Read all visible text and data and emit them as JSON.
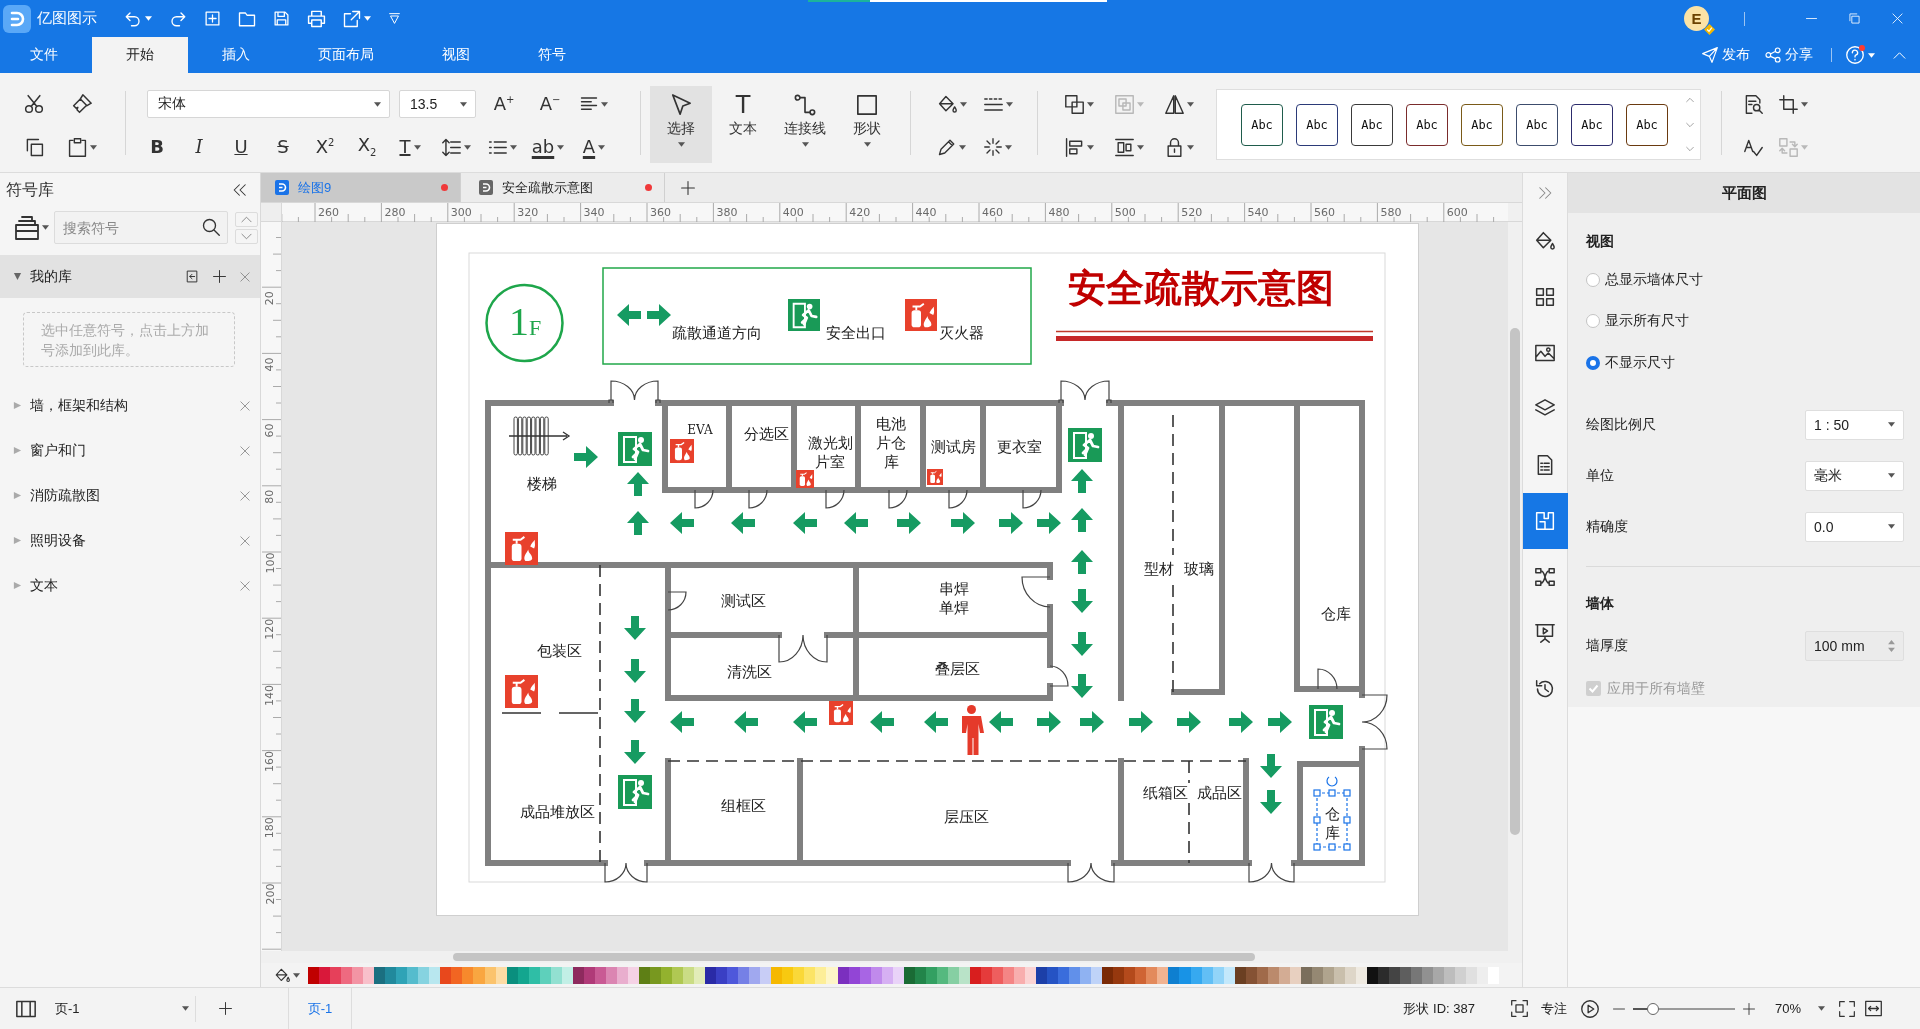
{
  "app": {
    "name": "亿图图示",
    "avatar": "E",
    "help_alert": true
  },
  "header_actions": [
    {
      "kind": "publish",
      "label": "发布"
    },
    {
      "kind": "share",
      "label": "分享"
    }
  ],
  "menu_tabs": [
    {
      "label": "文件",
      "selected": false
    },
    {
      "label": "开始",
      "selected": true
    },
    {
      "label": "插入",
      "selected": false
    },
    {
      "label": "页面布局",
      "selected": false
    },
    {
      "label": "视图",
      "selected": false
    },
    {
      "label": "符号",
      "selected": false
    }
  ],
  "ribbon": {
    "font_family": "宋体",
    "font_size": "13.5",
    "size_buttons": [
      {
        "glyph": "A$^{+}$"
      },
      {
        "glyph": "A$^{−}$"
      }
    ],
    "format_buttons": [
      {
        "kind": "bold",
        "glyph": "B"
      },
      {
        "kind": "italic",
        "glyph": "I"
      },
      {
        "kind": "underline",
        "glyph": "U"
      },
      {
        "kind": "strike",
        "glyph": "S"
      },
      {
        "kind": "script",
        "glyph": "X$^{2}$"
      },
      {
        "kind": "script",
        "glyph": "X$_{2}$"
      },
      {
        "kind": "style",
        "glyph": "T"
      },
      {
        "kind": "spacing"
      },
      {
        "kind": "bullets"
      },
      {
        "kind": "highlight",
        "glyph": "ab"
      },
      {
        "kind": "color",
        "glyph": "A"
      }
    ],
    "tools": [
      {
        "kind": "select",
        "label": "选择",
        "selected": true
      },
      {
        "kind": "text",
        "label": "文本",
        "glyph": "T",
        "selected": false
      },
      {
        "kind": "connector",
        "label": "连接线",
        "selected": false
      },
      {
        "kind": "shape",
        "label": "形状",
        "selected": false
      }
    ],
    "arrange_tools": [
      {
        "kind": "front",
        "disabled": false
      },
      {
        "kind": "group",
        "disabled": true
      },
      {
        "kind": "flip",
        "disabled": false
      },
      {
        "kind": "align",
        "disabled": false
      },
      {
        "kind": "distribute",
        "disabled": false
      },
      {
        "kind": "lock",
        "disabled": false
      }
    ],
    "style_gallery": [
      {
        "label": "Abc",
        "color": "#1f5c4c"
      },
      {
        "label": "Abc",
        "color": "#2b3a78"
      },
      {
        "label": "Abc",
        "color": "#3a3a3a"
      },
      {
        "label": "Abc",
        "color": "#7a2c2c"
      },
      {
        "label": "Abc",
        "color": "#7a5a18"
      },
      {
        "label": "Abc",
        "color": "#3c4c6c"
      },
      {
        "label": "Abc",
        "color": "#2c2c6c"
      },
      {
        "label": "Abc",
        "color": "#6a3a10"
      }
    ],
    "edit_tools": [
      {
        "kind": "find",
        "disabled": false
      },
      {
        "kind": "crop",
        "disabled": false
      },
      {
        "kind": "spell",
        "disabled": false
      },
      {
        "kind": "replace",
        "disabled": true
      }
    ]
  },
  "library": {
    "title": "符号库",
    "search": {
      "placeholder": "搜索符号"
    },
    "my_library": {
      "label": "我的库",
      "expanded": true,
      "hint": "选中任意符号，点击上方加号添加到此库。"
    },
    "categories": [
      {
        "label": "墙，框架和结构",
        "expanded": false
      },
      {
        "label": "窗户和门",
        "expanded": false
      },
      {
        "label": "消防疏散图",
        "expanded": false
      },
      {
        "label": "照明设备",
        "expanded": false
      },
      {
        "label": "文本",
        "expanded": false
      }
    ]
  },
  "doc_tabs": [
    {
      "label": "绘图9",
      "selected": true,
      "modified": true
    },
    {
      "label": "安全疏散示意图",
      "selected": false,
      "modified": true
    }
  ],
  "rulers": {
    "horizontal": [
      "260",
      "280",
      "300",
      "320",
      "340",
      "360",
      "380",
      "400",
      "420",
      "440",
      "460",
      "480",
      "500",
      "520",
      "540",
      "560",
      "580",
      "600"
    ],
    "vertical": [
      "20",
      "40",
      "60",
      "80",
      "100",
      "120",
      "140",
      "160",
      "180",
      "200"
    ]
  },
  "diagram": {
    "floor": {
      "number": "1",
      "suffix": "F"
    },
    "legend": [
      {
        "kind": "route",
        "label": "疏散通道方向"
      },
      {
        "kind": "exit",
        "label": "安全出口"
      },
      {
        "kind": "extinguisher",
        "label": "灭火器"
      }
    ],
    "title": "安全疏散示意图",
    "rooms": [
      {
        "lines": [
          "楼梯"
        ],
        "selected": false
      },
      {
        "lines": [
          "EVA"
        ],
        "selected": false
      },
      {
        "lines": [
          "分选区"
        ],
        "selected": false
      },
      {
        "lines": [
          "激光划",
          "片室"
        ],
        "selected": false
      },
      {
        "lines": [
          "电池",
          "片仓",
          "库"
        ],
        "selected": false
      },
      {
        "lines": [
          "测试房"
        ],
        "selected": false
      },
      {
        "lines": [
          "更衣室"
        ],
        "selected": false
      },
      {
        "lines": [
          "型材"
        ],
        "selected": false
      },
      {
        "lines": [
          "玻璃"
        ],
        "selected": false
      },
      {
        "lines": [
          "仓库"
        ],
        "selected": false
      },
      {
        "lines": [
          "测试区"
        ],
        "selected": false
      },
      {
        "lines": [
          "串焊",
          "单焊"
        ],
        "selected": false
      },
      {
        "lines": [
          "包装区"
        ],
        "selected": false
      },
      {
        "lines": [
          "清洗区"
        ],
        "selected": false
      },
      {
        "lines": [
          "叠层区"
        ],
        "selected": false
      },
      {
        "lines": [
          "成品堆放区"
        ],
        "selected": false
      },
      {
        "lines": [
          "组框区"
        ],
        "selected": false
      },
      {
        "lines": [
          "层压区"
        ],
        "selected": false
      },
      {
        "lines": [
          "纸箱区"
        ],
        "selected": false
      },
      {
        "lines": [
          "成品区"
        ],
        "selected": false
      },
      {
        "lines": [
          "仓",
          "库"
        ],
        "selected": true
      }
    ]
  },
  "side_tabs": [
    {
      "kind": "fill",
      "selected": false
    },
    {
      "kind": "grid",
      "selected": false
    },
    {
      "kind": "image",
      "selected": false
    },
    {
      "kind": "layers",
      "selected": false
    },
    {
      "kind": "page",
      "selected": false
    },
    {
      "kind": "plan",
      "selected": true
    },
    {
      "kind": "nodes",
      "selected": false
    },
    {
      "kind": "present",
      "selected": false
    },
    {
      "kind": "history",
      "selected": false
    }
  ],
  "properties": {
    "title": "平面图",
    "view": {
      "heading": "视图",
      "options": [
        {
          "label": "总显示墙体尺寸",
          "selected": false
        },
        {
          "label": "显示所有尺寸",
          "selected": false
        },
        {
          "label": "不显示尺寸",
          "selected": true
        }
      ]
    },
    "fields": [
      {
        "label": "绘图比例尺",
        "value": "1 : 50"
      },
      {
        "label": "单位",
        "value": "毫米"
      },
      {
        "label": "精确度",
        "value": "0.0"
      }
    ],
    "wall": {
      "heading": "墙体",
      "thickness": {
        "label": "墙厚度",
        "value": "100 mm",
        "disabled": true
      },
      "apply_all": {
        "label": "应用于所有墙壁",
        "checked": true,
        "disabled": true
      }
    }
  },
  "palette": [
    {
      "color": "#c00000"
    },
    {
      "color": "#d9183a"
    },
    {
      "color": "#e6405a"
    },
    {
      "color": "#ee6a80"
    },
    {
      "color": "#f394a4"
    },
    {
      "color": "#f8c0ca"
    },
    {
      "color": "#1b6f80"
    },
    {
      "color": "#21899c"
    },
    {
      "color": "#2fa3b6"
    },
    {
      "color": "#55bccd"
    },
    {
      "color": "#86d3e0"
    },
    {
      "color": "#b8e7ef"
    },
    {
      "color": "#e8481c"
    },
    {
      "color": "#f26522"
    },
    {
      "color": "#f7892c"
    },
    {
      "color": "#f9a640"
    },
    {
      "color": "#fbc36c"
    },
    {
      "color": "#fddca4"
    },
    {
      "color": "#0a8f7e"
    },
    {
      "color": "#13a68f"
    },
    {
      "color": "#2fbea6"
    },
    {
      "color": "#5ed0bb"
    },
    {
      "color": "#92e0d1"
    },
    {
      "color": "#c2efe6"
    },
    {
      "color": "#8e2a5e"
    },
    {
      "color": "#b03a78"
    },
    {
      "color": "#c95a94"
    },
    {
      "color": "#db85b2"
    },
    {
      "color": "#e9aece"
    },
    {
      "color": "#f5d2e5"
    },
    {
      "color": "#5e7f15"
    },
    {
      "color": "#78981f"
    },
    {
      "color": "#93b22e"
    },
    {
      "color": "#b0c853"
    },
    {
      "color": "#cadc85"
    },
    {
      "color": "#e2ecb8"
    },
    {
      "color": "#2a2aa6"
    },
    {
      "color": "#3a3fc4"
    },
    {
      "color": "#4e58db"
    },
    {
      "color": "#7580e6"
    },
    {
      "color": "#a0a8ef"
    },
    {
      "color": "#c8cdf6"
    },
    {
      "color": "#f5b800"
    },
    {
      "color": "#f8c910"
    },
    {
      "color": "#fad838"
    },
    {
      "color": "#fce466"
    },
    {
      "color": "#fdee98"
    },
    {
      "color": "#fef6c8"
    },
    {
      "color": "#7b2fbf"
    },
    {
      "color": "#9245d6"
    },
    {
      "color": "#a865e4"
    },
    {
      "color": "#c08aec"
    },
    {
      "color": "#d6b0f3"
    },
    {
      "color": "#e9d3f8"
    },
    {
      "color": "#1a6b35"
    },
    {
      "color": "#22854a"
    },
    {
      "color": "#33a062"
    },
    {
      "color": "#55b97f"
    },
    {
      "color": "#86cfa3"
    },
    {
      "color": "#b9e3c8"
    },
    {
      "color": "#d81e1e"
    },
    {
      "color": "#e53b3b"
    },
    {
      "color": "#ee5e5e"
    },
    {
      "color": "#f48585"
    },
    {
      "color": "#f8aeae"
    },
    {
      "color": "#fbd3d3"
    },
    {
      "color": "#1c3fa8"
    },
    {
      "color": "#2553c4"
    },
    {
      "color": "#3a6ddc"
    },
    {
      "color": "#6190ea"
    },
    {
      "color": "#8fb2f2"
    },
    {
      "color": "#bfd3f8"
    },
    {
      "color": "#7a2a06"
    },
    {
      "color": "#96380e"
    },
    {
      "color": "#b44a1c"
    },
    {
      "color": "#cf6434"
    },
    {
      "color": "#e38a5c"
    },
    {
      "color": "#f1b391"
    },
    {
      "color": "#0e7fd0"
    },
    {
      "color": "#1893e6"
    },
    {
      "color": "#36a9f0"
    },
    {
      "color": "#62bff5"
    },
    {
      "color": "#92d4f8"
    },
    {
      "color": "#c3e8fb"
    },
    {
      "color": "#6b3f22"
    },
    {
      "color": "#855234"
    },
    {
      "color": "#a06a4a"
    },
    {
      "color": "#bb8a6c"
    },
    {
      "color": "#d3ac94"
    },
    {
      "color": "#e8d0c0"
    },
    {
      "color": "#7a6e5c"
    },
    {
      "color": "#958873"
    },
    {
      "color": "#b0a48e"
    },
    {
      "color": "#c9bfac"
    },
    {
      "color": "#ded6c8"
    },
    {
      "color": "#efeae1"
    },
    {
      "color": "#111111"
    },
    {
      "color": "#2b2b2b"
    },
    {
      "color": "#444444"
    },
    {
      "color": "#5e5e5e"
    },
    {
      "color": "#777777"
    },
    {
      "color": "#919191"
    },
    {
      "color": "#a8a8a8"
    },
    {
      "color": "#bdbdbd"
    },
    {
      "color": "#d0d0d0"
    },
    {
      "color": "#e0e0e0"
    },
    {
      "color": "#eeeeee"
    },
    {
      "color": "#ffffff"
    }
  ],
  "status_bar": {
    "page_select": "页-1",
    "page_tab": {
      "label": "页-1",
      "selected": true
    },
    "shape_id": "形状 ID: 387",
    "focus": "专注",
    "zoom": {
      "level": 0.2,
      "value": "70%"
    }
  }
}
